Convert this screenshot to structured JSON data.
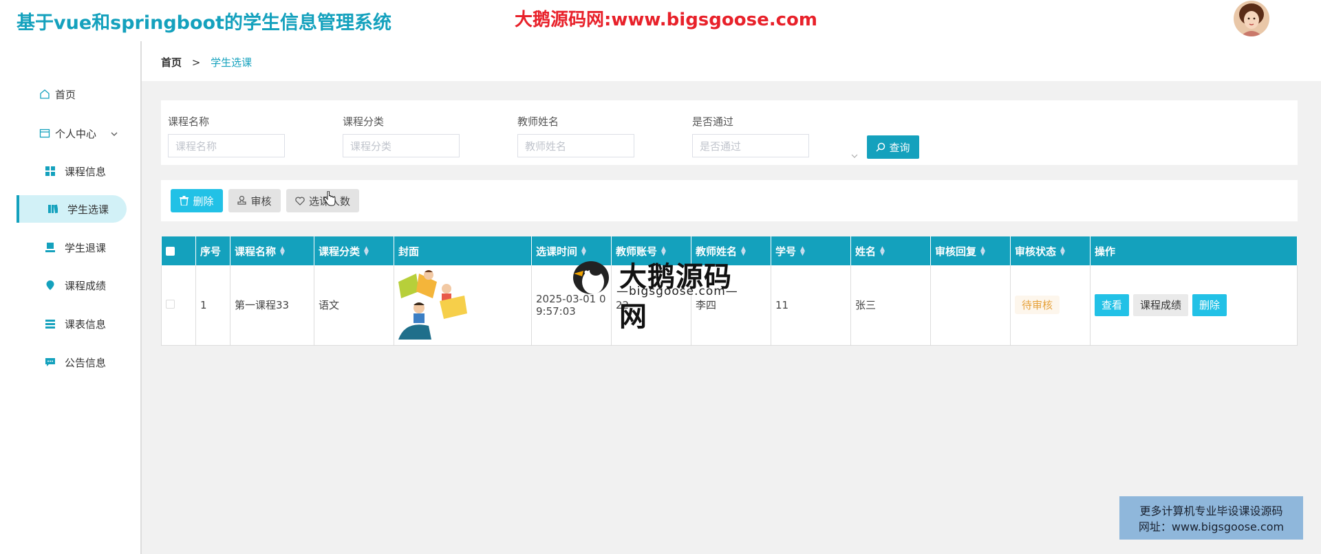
{
  "header": {
    "title": "基于vue和springboot的学生信息管理系统",
    "watermark": "大鹅源码网:www.bigsgoose.com"
  },
  "sidebar": {
    "items": [
      {
        "label": "首页",
        "icon": "home-icon"
      },
      {
        "label": "个人中心",
        "icon": "profile-card-icon"
      },
      {
        "label": "课程信息",
        "icon": "grid-icon"
      },
      {
        "label": "学生选课",
        "icon": "book-icon"
      },
      {
        "label": "学生退课",
        "icon": "tray-icon"
      },
      {
        "label": "课程成绩",
        "icon": "location-pin-icon"
      },
      {
        "label": "课表信息",
        "icon": "list-icon"
      },
      {
        "label": "公告信息",
        "icon": "chat-icon"
      }
    ],
    "active_index": 3
  },
  "breadcrumb": {
    "home": "首页",
    "separator": ">",
    "current": "学生选课"
  },
  "search": {
    "fields": [
      {
        "label": "课程名称",
        "placeholder": "课程名称"
      },
      {
        "label": "课程分类",
        "placeholder": "课程分类"
      },
      {
        "label": "教师姓名",
        "placeholder": "教师姓名"
      },
      {
        "label": "是否通过",
        "placeholder": "是否通过"
      }
    ],
    "query_label": "查询"
  },
  "actions": {
    "delete_label": "删除",
    "audit_label": "审核",
    "count_label": "选课人数"
  },
  "table": {
    "headers": [
      "序号",
      "课程名称",
      "课程分类",
      "封面",
      "选课时间",
      "教师账号",
      "教师姓名",
      "学号",
      "姓名",
      "审核回复",
      "审核状态",
      "操作"
    ],
    "rows": [
      {
        "index": "1",
        "course_name": "第一课程33",
        "category": "语文",
        "time_line1": "2025-03-01 0",
        "time_line2": "9:57:03",
        "teacher_account": "22",
        "teacher_name": "李四",
        "student_no": "11",
        "student_name": "张三",
        "reply": "",
        "status": "待审核",
        "ops": {
          "view": "查看",
          "score": "课程成绩",
          "delete": "删除"
        }
      }
    ]
  },
  "overlay": {
    "center_cn": "大鹅源码网",
    "center_en": "—bigsgoose.com—",
    "promo_line1": "更多计算机专业毕设课设源码",
    "promo_line2": "网址：www.bigsgoose.com"
  },
  "colors": {
    "accent": "#14a1bd",
    "button_blue": "#22c1e6",
    "watermark_red": "#e8212a",
    "pending_orange": "#e6a23c"
  }
}
